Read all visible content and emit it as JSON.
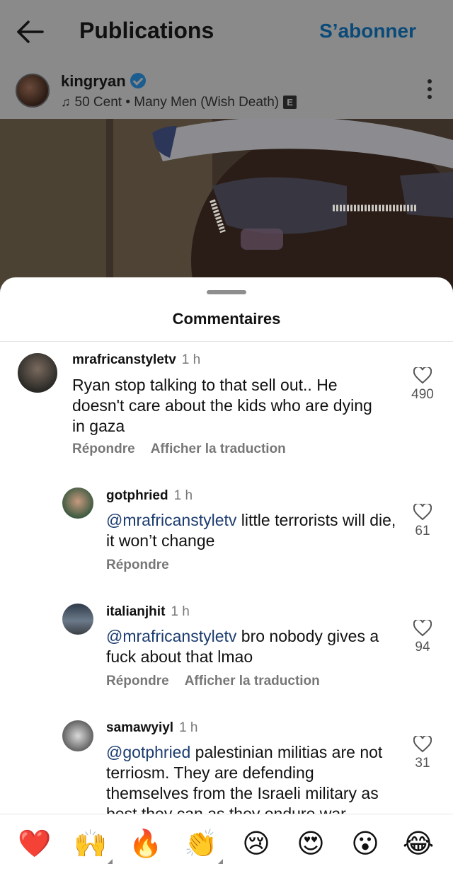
{
  "header": {
    "title": "Publications",
    "subscribe_label": "S’abonner"
  },
  "post": {
    "author": "kingryan",
    "song": "50 Cent • Many Men (Wish Death)",
    "explicit_badge": "E"
  },
  "comments_sheet": {
    "title": "Commentaires",
    "comments": [
      {
        "username": "mrafricanstyletv",
        "time": "1 h",
        "mention": "",
        "text": "Ryan stop talking to that sell out.. He doesn't care about the kids who are dying in gaza",
        "likes": "490",
        "reply_label": "Répondre",
        "translate_label": "Afficher la traduction"
      },
      {
        "username": "gotphried",
        "time": "1 h",
        "mention": "@mrafricanstyletv",
        "text": " little terrorists will die, it won’t change",
        "likes": "61",
        "reply_label": "Répondre",
        "translate_label": ""
      },
      {
        "username": "italianjhit",
        "time": "1 h",
        "mention": "@mrafricanstyletv",
        "text": " bro nobody gives a fuck about that lmao",
        "likes": "94",
        "reply_label": "Répondre",
        "translate_label": "Afficher la traduction"
      },
      {
        "username": "samawyiyl",
        "time": "1 h",
        "mention": "@gotphried",
        "text": " palestinian militias are not terriosm. They are defending themselves from the Israeli military as best they can as they endure war",
        "likes": "31",
        "reply_label": "",
        "translate_label": ""
      }
    ]
  },
  "emoji_bar": {
    "emojis": [
      "❤️",
      "🙌",
      "🔥",
      "👏",
      "😢",
      "😍",
      "😮",
      "😂"
    ]
  },
  "colors": {
    "accent_link": "#0a4a79",
    "mention": "#1b3b6f",
    "verified": "#1c5d8f"
  }
}
